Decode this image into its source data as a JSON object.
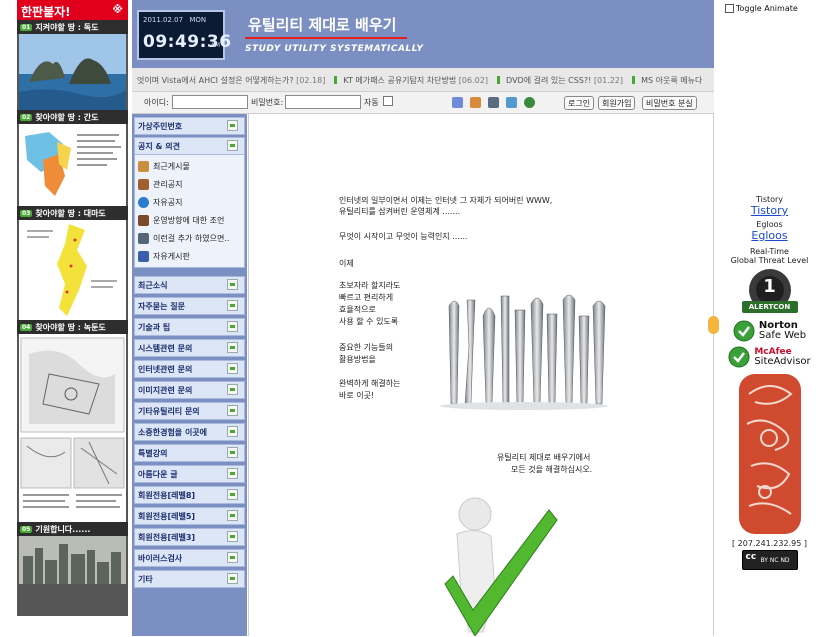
{
  "left_panel": {
    "header": "한판붙자!",
    "close": "※",
    "promos": [
      {
        "tag": "01",
        "title": "지켜야할 땅 : 독도"
      },
      {
        "tag": "02",
        "title": "찾아야할 땅 : 간도"
      },
      {
        "tag": "03",
        "title": "찾아야할 땅 : 대마도"
      },
      {
        "tag": "04",
        "title": "찾아야할 땅 : 녹둔도"
      },
      {
        "tag": "05",
        "title": "기원합니다......"
      }
    ]
  },
  "header": {
    "clock_date": "2011.02.07",
    "clock_day": "MON",
    "clock_time": "09:49:36",
    "clock_ampm": "AM",
    "title": "유틸리티 제대로 배우기",
    "subtitle": "STUDY UTILITY SYSTEMATICALLY"
  },
  "ticker": [
    {
      "text": "엇이며 Vista에서 AHCI 설정은 어떻게하는가?",
      "date": "[02.18]"
    },
    {
      "text": "KT 메가패스 공유기탐지 차단방법",
      "date": "[06.02]"
    },
    {
      "text": "DVD에 걸려 있는 CSS?!",
      "date": "[01.22]"
    },
    {
      "text": "MS 아웃룩 메뉴다",
      "date": ""
    }
  ],
  "login": {
    "id_label": "아이디:",
    "pw_label": "비밀번호:",
    "auto_label": "자동",
    "login_btn": "로그인",
    "join_btn": "회원가입",
    "lost_btn": "비밀번호 분실"
  },
  "menu": {
    "top": [
      "가상주민번호",
      "공지 & 의견"
    ],
    "sub": [
      "최근게시물",
      "관리공지",
      "자유공지",
      "운영방향에 대한 조언",
      "이런걸 추가 하였으면..",
      "자유게시판"
    ],
    "items": [
      "최근소식",
      "자주묻는 질문",
      "기술과 팁",
      "시스템관련 문의",
      "인터넷관련 문의",
      "이미지관련 문의",
      "기타유틸리티 문의",
      "소중한경험을 이곳에",
      "특별강의",
      "아름다운 글",
      "회원전용[레벨8]",
      "회원전용[레벨5]",
      "회원전용[레벨3]",
      "바이러스검사",
      "기타"
    ]
  },
  "main": {
    "para1_line1": "인터넷의 일부이면서 이제는 인터넷 그 자체가 되어버린 WWW,",
    "para1_line2": "유틸리티를 삼켜버린 운영체계 .......",
    "para2": "무엇이 시작이고 무엇이 능력인지 ......",
    "para3": "이제",
    "para4": [
      "초보자라 할지라도",
      "빠르고 편리하게",
      "효율적으로",
      "사용 할 수 있도록"
    ],
    "para5": [
      "중요한 기능들의",
      "활용방법을"
    ],
    "para6": [
      "완벽하게 해결하는",
      "바로 이곳!"
    ],
    "closing1": "유틸리티 제대로 배우기에서",
    "closing2": "모든 것을 해결하십시오."
  },
  "right_panel": {
    "toggle_label": "Toggle Animate",
    "tistory_label": "Tistory",
    "tistory_link": "Tistory",
    "egloos_label": "Egloos",
    "egloos_link": "Egloos",
    "threat_line1": "Real-Time",
    "threat_line2": "Global Threat Level",
    "alertcon_level": "1",
    "alertcon_text": "ALERTCON",
    "norton_line1": "Norton",
    "norton_line2": "Safe Web",
    "mcafee_line1": "McAfee",
    "mcafee_line2": "SiteAdvisor",
    "ip": "[ 207.241.232.95 ]",
    "cc_text": "cc",
    "cc_tags": "BY  NC  ND"
  }
}
